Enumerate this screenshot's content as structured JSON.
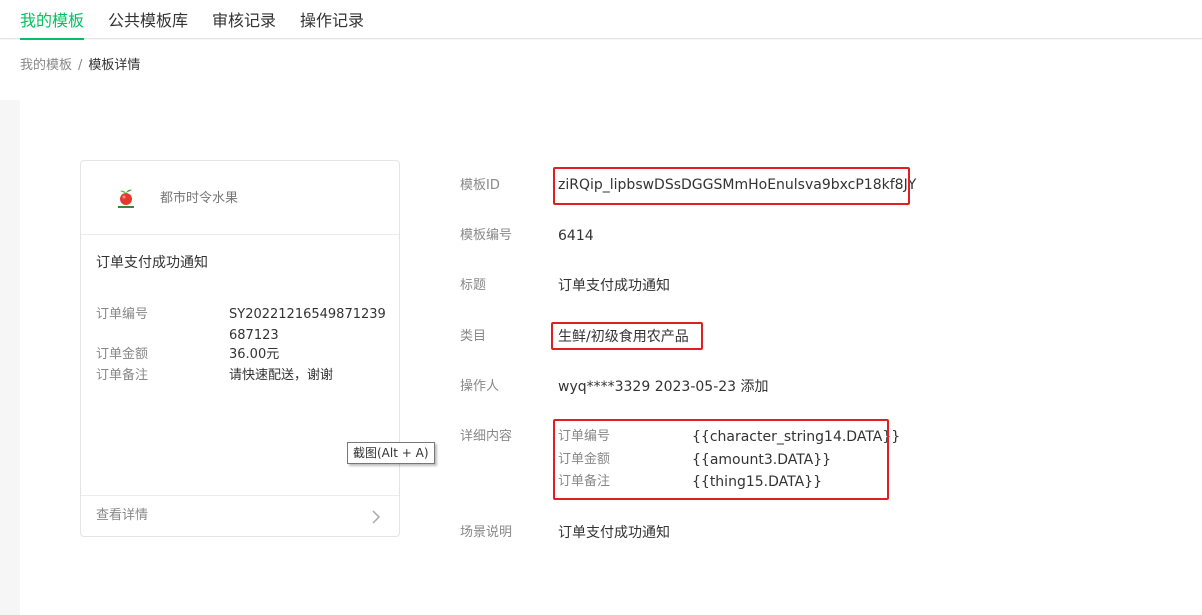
{
  "tabs": [
    {
      "label": "我的模板",
      "active": true
    },
    {
      "label": "公共模板库",
      "active": false
    },
    {
      "label": "审核记录",
      "active": false
    },
    {
      "label": "操作记录",
      "active": false
    }
  ],
  "breadcrumb": {
    "parent": "我的模板",
    "separator": "/",
    "current": "模板详情"
  },
  "preview": {
    "brand_name": "都市时令水果",
    "title": "订单支付成功通知",
    "fields": [
      {
        "label": "订单编号",
        "value": "SY20221216549871239687123"
      },
      {
        "label": "订单金额",
        "value": "36.00元"
      },
      {
        "label": "订单备注",
        "value": "请快速配送，谢谢"
      }
    ],
    "view_details": "查看详情"
  },
  "tooltip": "截图(Alt + A)",
  "details": {
    "template_id": {
      "label": "模板ID",
      "value": "ziRQip_lipbswDSsDGGSMmHoEnulsva9bxcP18kf8JY"
    },
    "template_no": {
      "label": "模板编号",
      "value": "6414"
    },
    "title": {
      "label": "标题",
      "value": "订单支付成功通知"
    },
    "category": {
      "label": "类目",
      "value": "生鲜/初级食用农产品"
    },
    "operator": {
      "label": "操作人",
      "value": "wyq****3329 2023-05-23 添加"
    },
    "content": {
      "label": "详细内容",
      "rows": [
        {
          "label": "订单编号",
          "value": "{{character_string14.DATA}}"
        },
        {
          "label": "订单金额",
          "value": "{{amount3.DATA}}"
        },
        {
          "label": "订单备注",
          "value": "{{thing15.DATA}}"
        }
      ]
    },
    "scene": {
      "label": "场景说明",
      "value": "订单支付成功通知"
    }
  },
  "colors": {
    "accent": "#07c160",
    "highlight_box": "#e02020",
    "label": "#888888",
    "text": "#333333"
  },
  "icons": {
    "logo": "fruit-logo-icon",
    "chevron": "chevron-right-icon"
  }
}
